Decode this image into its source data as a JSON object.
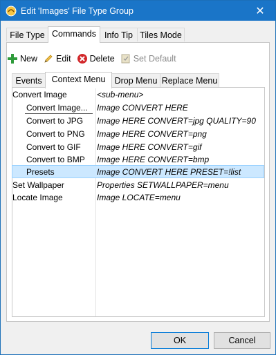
{
  "window": {
    "title": "Edit 'Images' File Type Group"
  },
  "outer_tabs": [
    "File Type",
    "Commands",
    "Info Tip",
    "Tiles Mode"
  ],
  "toolbar": {
    "new_label": "New",
    "edit_label": "Edit",
    "delete_label": "Delete",
    "set_default_label": "Set Default"
  },
  "inner_tabs": [
    "Events",
    "Context Menu",
    "Drop Menu",
    "Replace Menu"
  ],
  "rows": [
    {
      "name": "Convert Image",
      "command": "<sub-menu>"
    },
    {
      "name": "Convert Image...",
      "command": "Image CONVERT HERE"
    },
    {
      "name": "Convert to JPG",
      "command": "Image HERE CONVERT=jpg QUALITY=90"
    },
    {
      "name": "Convert to PNG",
      "command": "Image HERE CONVERT=png"
    },
    {
      "name": "Convert to GIF",
      "command": "Image HERE CONVERT=gif"
    },
    {
      "name": "Convert to BMP",
      "command": "Image HERE CONVERT=bmp"
    },
    {
      "name": "Presets",
      "command": "Image CONVERT HERE PRESET=!list"
    },
    {
      "name": "Set Wallpaper",
      "command": "Properties SETWALLPAPER=menu"
    },
    {
      "name": "Locate Image",
      "command": "Image LOCATE=menu"
    }
  ],
  "buttons": {
    "ok": "OK",
    "cancel": "Cancel"
  },
  "colors": {
    "titlebar": "#1a75c8",
    "selection": "#cce8ff",
    "new_icon": "#2e9b3a",
    "delete_icon": "#d2282b"
  }
}
